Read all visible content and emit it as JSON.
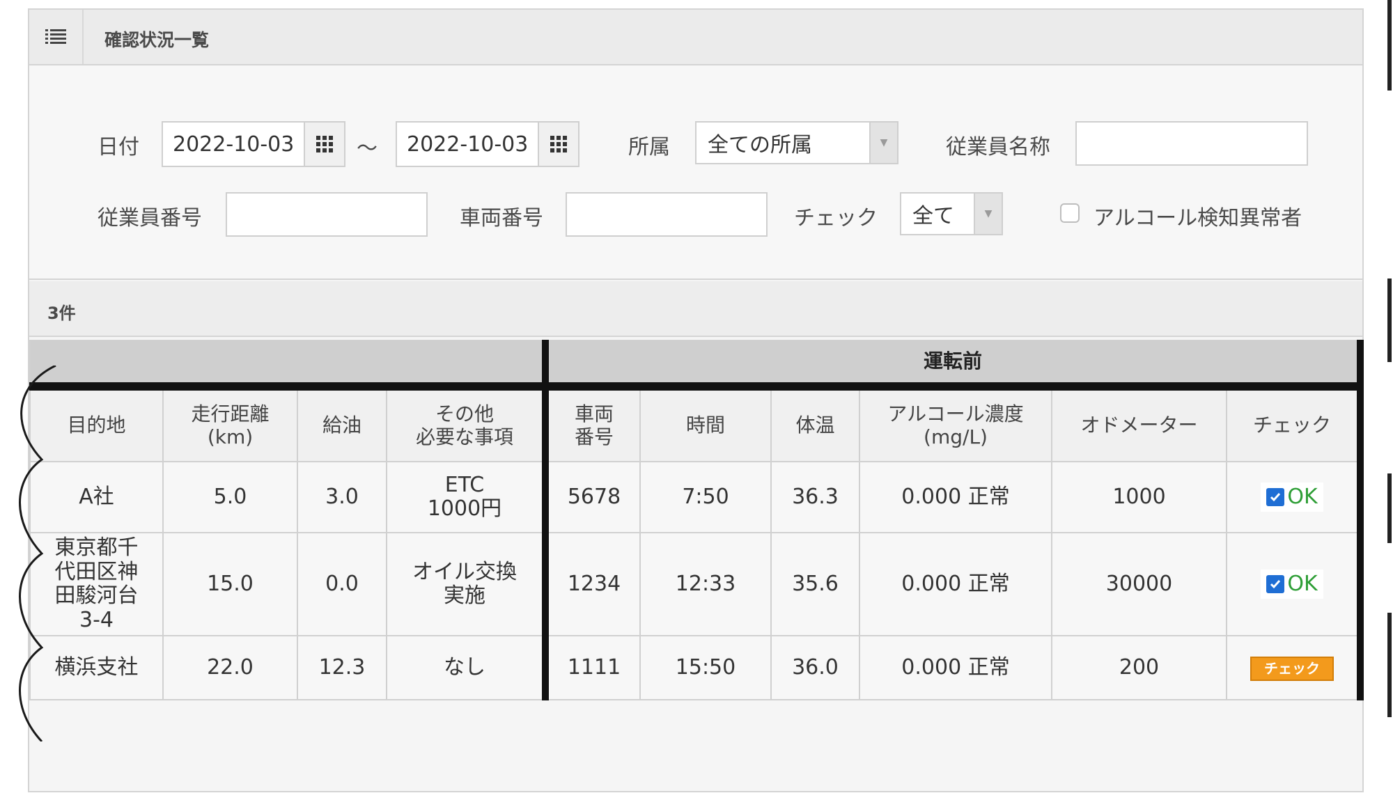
{
  "header": {
    "title": "確認状況一覧",
    "menu_icon": "list-icon"
  },
  "filters": {
    "date_label": "日付",
    "date_from": "2022-10-03",
    "date_separator": "～",
    "date_to": "2022-10-03",
    "dept_label": "所属",
    "dept_value": "全ての所属",
    "employee_name_label": "従業員名称",
    "employee_name_value": "",
    "employee_no_label": "従業員番号",
    "employee_no_value": "",
    "vehicle_no_label": "車両番号",
    "vehicle_no_value": "",
    "check_label": "チェック",
    "check_value": "全て",
    "alcohol_abnormal_label": "アルコール検知異常者",
    "alcohol_abnormal_checked": false
  },
  "count_label": "3件",
  "table": {
    "group_header": "運転前",
    "headers": {
      "destination": "目的地",
      "distance_1": "走行距離",
      "distance_2": "(km)",
      "fuel": "給油",
      "other_1": "その他",
      "other_2": "必要な事項",
      "vehicle_1": "車両",
      "vehicle_2": "番号",
      "time": "時間",
      "temp": "体温",
      "alcohol_1": "アルコール濃度",
      "alcohol_2": "(mg/L)",
      "odometer": "オドメーター",
      "check": "チェック"
    },
    "rows": [
      {
        "destination": [
          "A社"
        ],
        "distance": "5.0",
        "fuel": "3.0",
        "other": [
          "ETC",
          "1000円"
        ],
        "vehicle": "5678",
        "time": "7:50",
        "temp": "36.3",
        "alcohol": "0.000 正常",
        "odometer": "1000",
        "check_type": "ok",
        "check_label": "OK"
      },
      {
        "destination": [
          "東京都千",
          "代田区神",
          "田駿河台",
          "3-4"
        ],
        "distance": "15.0",
        "fuel": "0.0",
        "other": [
          "オイル交換",
          "実施"
        ],
        "vehicle": "1234",
        "time": "12:33",
        "temp": "35.6",
        "alcohol": "0.000 正常",
        "odometer": "30000",
        "check_type": "ok",
        "check_label": "OK"
      },
      {
        "destination": [
          "横浜支社"
        ],
        "distance": "22.0",
        "fuel": "12.3",
        "other": [
          "なし"
        ],
        "vehicle": "1111",
        "time": "15:50",
        "temp": "36.0",
        "alcohol": "0.000 正常",
        "odometer": "200",
        "check_type": "button",
        "check_label": "チェック"
      }
    ]
  },
  "colors": {
    "ok_green": "#2e9e36",
    "checkbox_blue": "#1f6ed4",
    "check_button_orange": "#f39a1c",
    "divider_black": "#111111"
  }
}
